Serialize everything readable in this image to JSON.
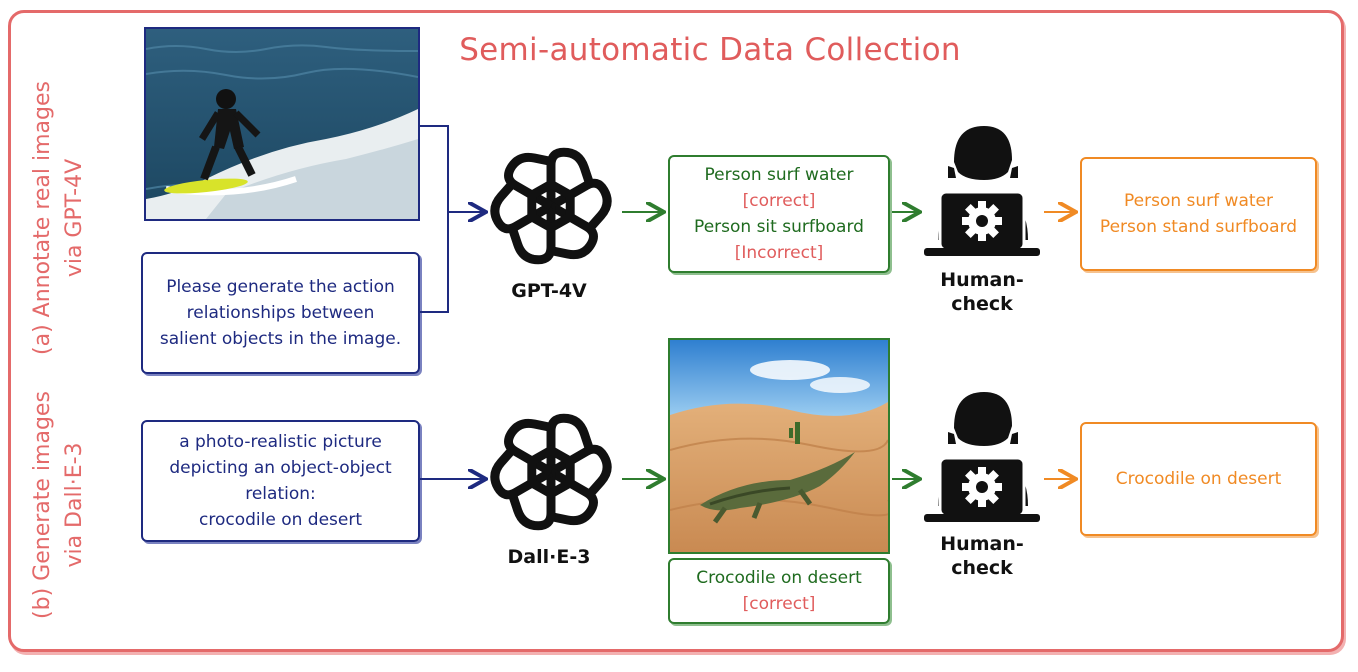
{
  "title": "Semi-automatic Data Collection",
  "rows": {
    "a": {
      "side_label_line1": "(a) Annotate real images",
      "side_label_line2": "via GPT-4V",
      "prompt": [
        "Please generate the action",
        "relationships between",
        "salient objects in the image."
      ],
      "model": "GPT-4V",
      "results": [
        {
          "text": "Person surf water",
          "tag": "[correct]"
        },
        {
          "text": "Person sit surfboard",
          "tag": "[Incorrect]"
        }
      ],
      "check_line1": "Human-",
      "check_line2": "check",
      "final": [
        "Person surf water",
        "Person stand surfboard"
      ]
    },
    "b": {
      "side_label_line1": "(b) Generate images",
      "side_label_line2": "via Dall·E-3",
      "prompt": [
        "a photo-realistic picture",
        "depicting an object-object",
        "relation:",
        "crocodile on desert"
      ],
      "model": "Dall·E-3",
      "result": {
        "text": "Crocodile on desert",
        "tag": "[correct]"
      },
      "check_line1": "Human-",
      "check_line2": "check",
      "final": [
        "Crocodile on desert"
      ]
    }
  },
  "icons": {
    "model_logo": "openai-logo-icon",
    "human_check": "person-laptop-gear-icon",
    "arrow": "arrow-right-icon"
  },
  "colors": {
    "frame": "#e46a6a",
    "prompt": "#1e2a80",
    "result": "#2f7d2f",
    "final": "#f08a24",
    "wrong_tag": "#e05c5c"
  }
}
